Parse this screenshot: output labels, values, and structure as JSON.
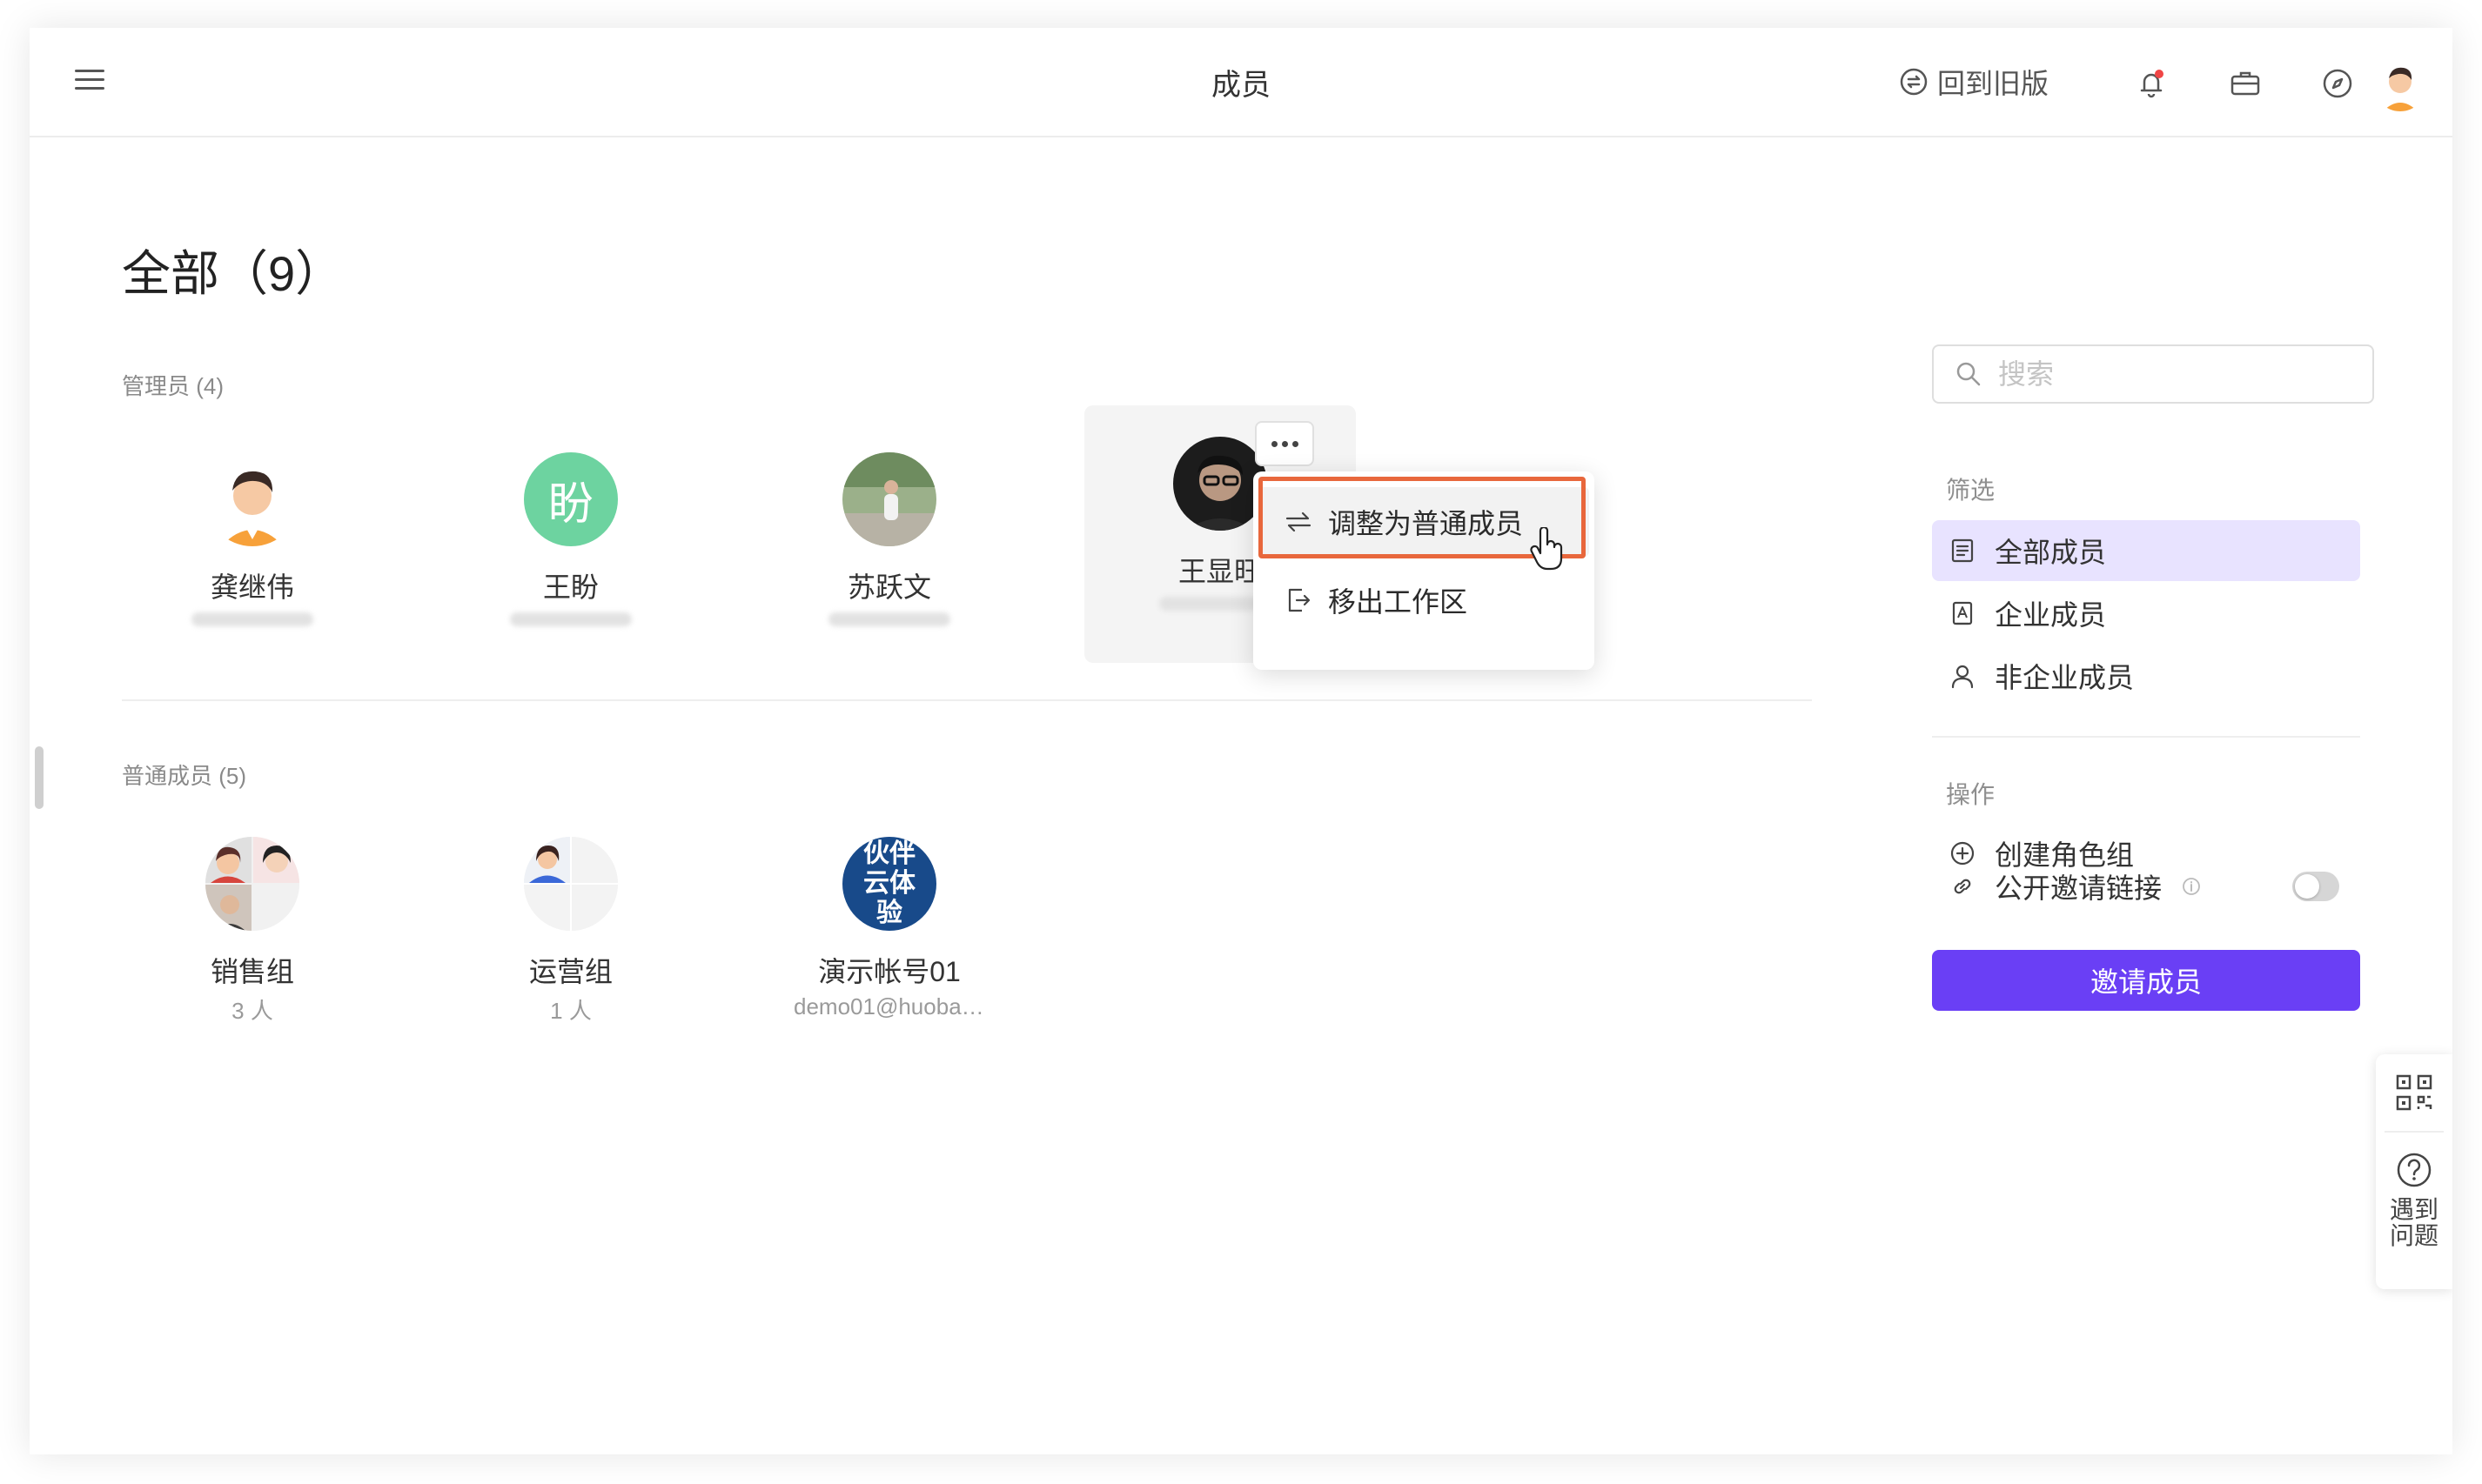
{
  "header": {
    "title": "成员",
    "back_old_label": "回到旧版",
    "notification_dot_color": "#f04545"
  },
  "page": {
    "section_title": "全部（9）"
  },
  "admins": {
    "label": "管理员 (4)",
    "members": [
      {
        "name": "龚继伟",
        "avatar": "cartoon-man-avatar"
      },
      {
        "name": "王盼",
        "avatar_text": "盼",
        "avatar_color": "#6dd3a0"
      },
      {
        "name": "苏跃文",
        "avatar": "photo-avatar"
      },
      {
        "name": "王显旺",
        "avatar": "photo-avatar"
      }
    ]
  },
  "regular": {
    "label": "普通成员 (5)",
    "members": [
      {
        "name": "销售组",
        "sub": "3 人"
      },
      {
        "name": "运营组",
        "sub": "1 人"
      },
      {
        "name": "演示帐号01",
        "sub": "demo01@huoban....",
        "avatar_text": "伙伴云体验",
        "avatar_color": "#184a8a"
      }
    ]
  },
  "dropdown": {
    "items": [
      {
        "label": "调整为普通成员",
        "icon": "swap-icon"
      },
      {
        "label": "移出工作区",
        "icon": "exit-icon"
      }
    ],
    "highlight_color": "#e8673c"
  },
  "sidebar": {
    "search_placeholder": "搜索",
    "filter_label": "筛选",
    "filters": [
      {
        "label": "全部成员",
        "icon": "list-icon"
      },
      {
        "label": "企业成员",
        "icon": "enterprise-icon"
      },
      {
        "label": "非企业成员",
        "icon": "person-icon"
      }
    ],
    "actions_label": "操作",
    "actions": [
      {
        "label": "创建角色组",
        "icon": "plus-circle-icon"
      },
      {
        "label": "公开邀请链接",
        "icon": "link-icon"
      }
    ],
    "invite_label": "邀请成员",
    "accent_color": "#6a3ff5"
  },
  "float_panel": {
    "help_label": "遇到问题"
  }
}
